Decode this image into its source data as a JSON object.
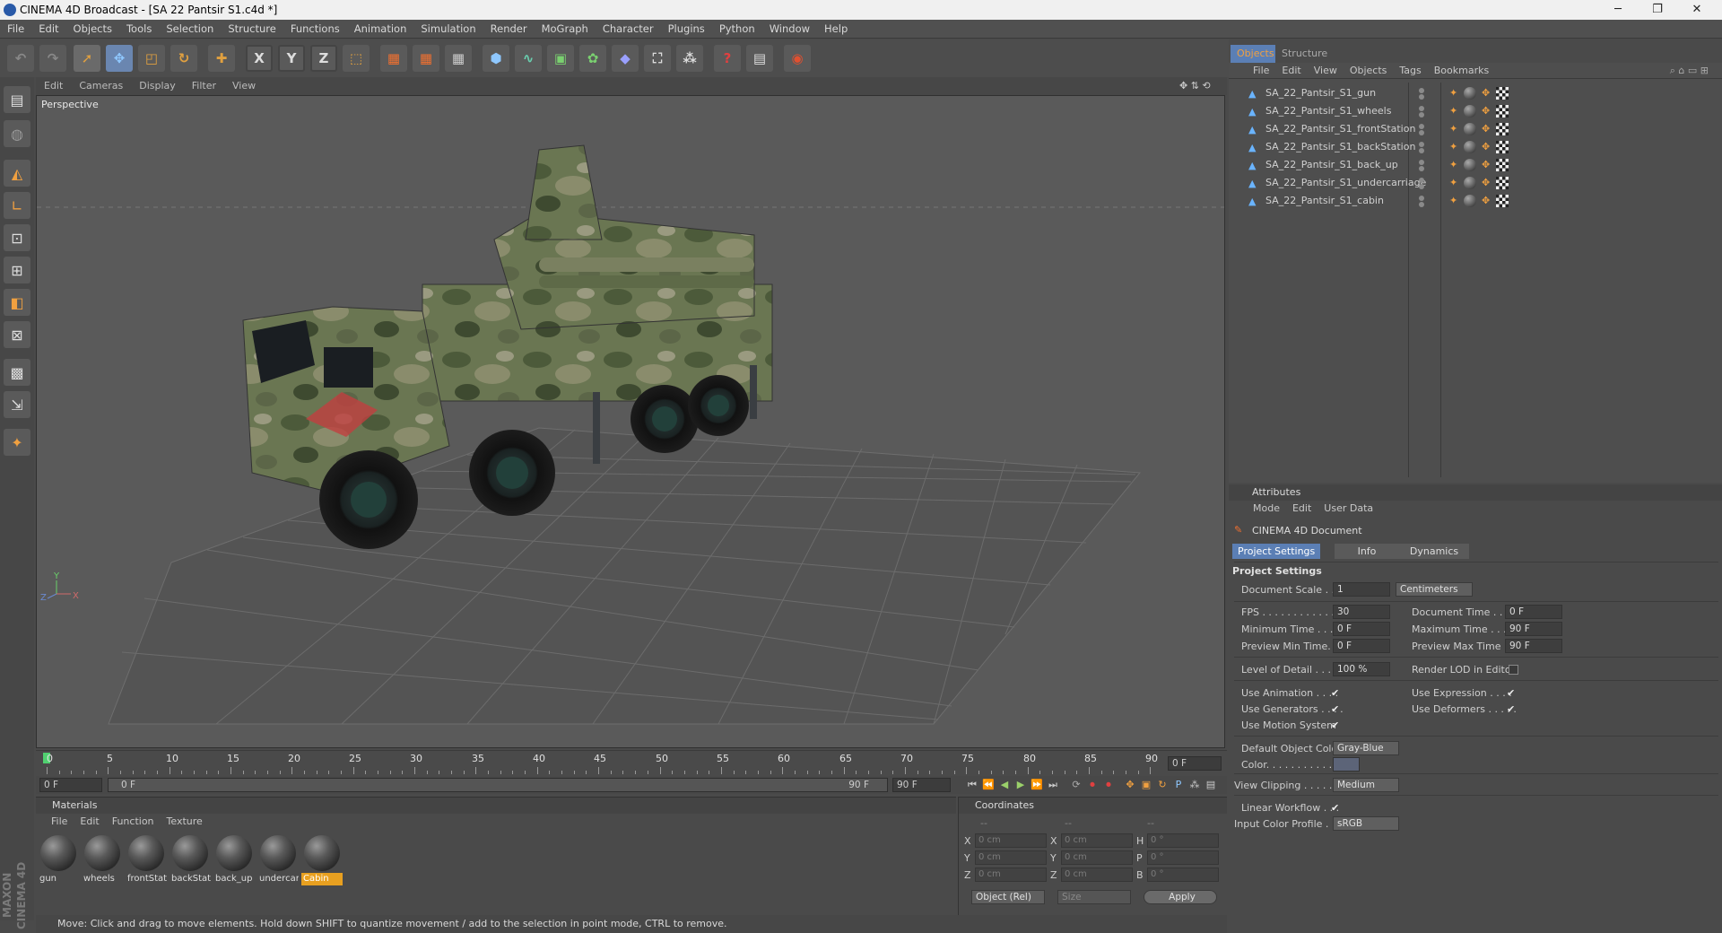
{
  "window": {
    "title": "CINEMA 4D Broadcast - [SA 22 Pantsir S1.c4d *]",
    "minimize": "─",
    "maximize": "❐",
    "close": "✕"
  },
  "menu": [
    "File",
    "Edit",
    "Objects",
    "Tools",
    "Selection",
    "Structure",
    "Functions",
    "Animation",
    "Simulation",
    "Render",
    "MoGraph",
    "Character",
    "Plugins",
    "Python",
    "Window",
    "Help"
  ],
  "viewport": {
    "menu": [
      "Edit",
      "Cameras",
      "Display",
      "Filter",
      "View"
    ],
    "label": "Perspective",
    "axis": {
      "y": "Y",
      "x": "X",
      "z": "Z"
    }
  },
  "timeline": {
    "ticks": [
      "0",
      "5",
      "10",
      "15",
      "20",
      "25",
      "30",
      "35",
      "40",
      "45",
      "50",
      "55",
      "60",
      "65",
      "70",
      "75",
      "80",
      "85",
      "90"
    ],
    "current_frame": "0 F",
    "start": "0 F",
    "range_start": "0 F",
    "range_end": "90 F",
    "end": "90 F"
  },
  "materials": {
    "title": "Materials",
    "menu": [
      "File",
      "Edit",
      "Function",
      "Texture"
    ],
    "items": [
      "gun",
      "wheels",
      "frontStati",
      "backStat",
      "back_up",
      "undercar",
      "Cabin"
    ],
    "selected": "Cabin"
  },
  "coordinates": {
    "title": "Coordinates",
    "col_heads": [
      "--",
      "--",
      "--"
    ],
    "rows": [
      {
        "a": "X",
        "av": "0 cm",
        "b": "X",
        "bv": "0 cm",
        "c": "H",
        "cv": "0 °"
      },
      {
        "a": "Y",
        "av": "0 cm",
        "b": "Y",
        "bv": "0 cm",
        "c": "P",
        "cv": "0 °"
      },
      {
        "a": "Z",
        "av": "0 cm",
        "b": "Z",
        "bv": "0 cm",
        "c": "B",
        "cv": "0 °"
      }
    ],
    "mode": "Object (Rel)",
    "size": "Size",
    "apply": "Apply"
  },
  "status": "Move: Click and drag to move elements. Hold down SHIFT to quantize movement / add to the selection in point mode, CTRL to remove.",
  "objects_panel": {
    "tabs": [
      "Objects",
      "Structure"
    ],
    "menu": [
      "File",
      "Edit",
      "View",
      "Objects",
      "Tags",
      "Bookmarks"
    ],
    "items": [
      "SA_22_Pantsir_S1_gun",
      "SA_22_Pantsir_S1_wheels",
      "SA_22_Pantsir_S1_frontStation",
      "SA_22_Pantsir_S1_backStation",
      "SA_22_Pantsir_S1_back_up",
      "SA_22_Pantsir_S1_undercarriage",
      "SA_22_Pantsir_S1_cabin"
    ]
  },
  "attributes": {
    "title": "Attributes",
    "menu": [
      "Mode",
      "Edit",
      "User Data"
    ],
    "doc": "CINEMA 4D Document",
    "tabs": [
      "Project Settings",
      "Info",
      "Dynamics"
    ],
    "section": "Project Settings",
    "document_scale": {
      "label": "Document Scale . .",
      "value": "1",
      "unit": "Centimeters"
    },
    "fps": {
      "label": "FPS . . . . . . . . . . . .",
      "value": "30"
    },
    "document_time": {
      "label": "Document Time . .",
      "value": "0 F"
    },
    "minimum_time": {
      "label": "Minimum Time . . . .",
      "value": "0 F"
    },
    "maximum_time": {
      "label": "Maximum Time . . . .",
      "value": "90 F"
    },
    "preview_min": {
      "label": "Preview Min Time. .",
      "value": "0 F"
    },
    "preview_max": {
      "label": "Preview Max Time . .",
      "value": "90 F"
    },
    "lod": {
      "label": "Level of Detail . . . .",
      "value": "100 %"
    },
    "render_lod": {
      "label": "Render LOD in Editor"
    },
    "use_animation": {
      "label": "Use Animation . . . ."
    },
    "use_expression": {
      "label": "Use Expression . . . ."
    },
    "use_generators": {
      "label": "Use Generators . . . ."
    },
    "use_deformers": {
      "label": "Use Deformers . . . . ."
    },
    "use_motion": {
      "label": "Use Motion System"
    },
    "default_color": {
      "label": "Default Object Color",
      "value": "Gray-Blue"
    },
    "color": {
      "label": "Color. . . . . . . . . . . ."
    },
    "view_clipping": {
      "label": "View Clipping . . . . .",
      "value": "Medium"
    },
    "linear_workflow": {
      "label": "Linear Workflow . . ."
    },
    "color_profile": {
      "label": "Input Color Profile .",
      "value": "sRGB"
    }
  }
}
